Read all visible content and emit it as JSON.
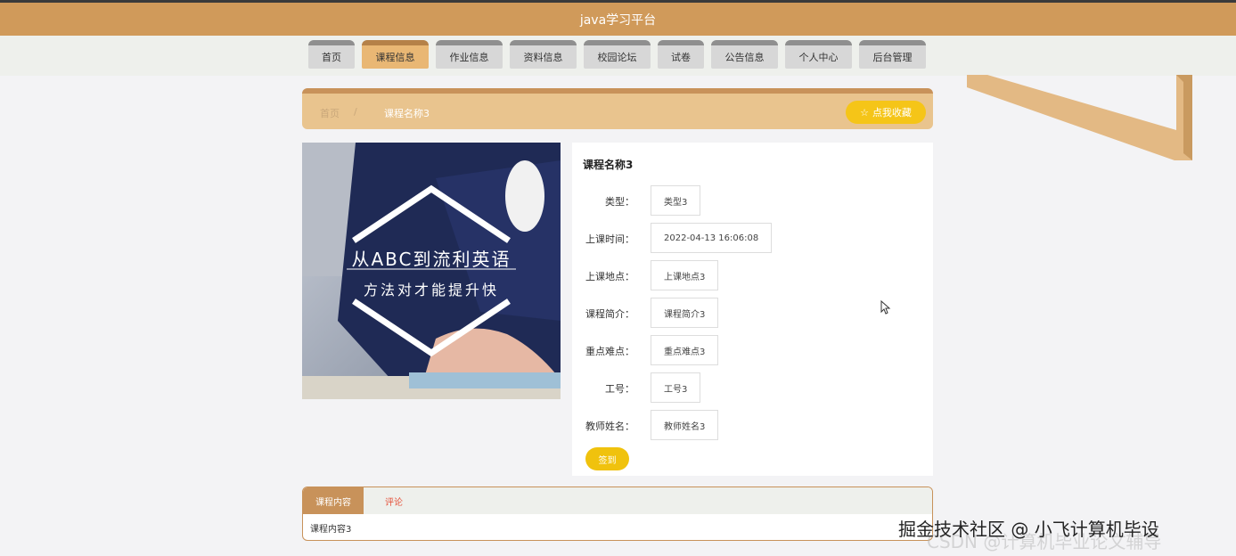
{
  "header": {
    "title": "java学习平台"
  },
  "nav": {
    "items": [
      {
        "label": "首页",
        "active": false,
        "width": 52
      },
      {
        "label": "课程信息",
        "active": true,
        "width": 75
      },
      {
        "label": "作业信息",
        "active": false,
        "width": 75
      },
      {
        "label": "资料信息",
        "active": false,
        "width": 75
      },
      {
        "label": "校园论坛",
        "active": false,
        "width": 75
      },
      {
        "label": "试卷",
        "active": false,
        "width": 52
      },
      {
        "label": "公告信息",
        "active": false,
        "width": 75
      },
      {
        "label": "个人中心",
        "active": false,
        "width": 75
      },
      {
        "label": "后台管理",
        "active": false,
        "width": 75
      }
    ]
  },
  "breadcrumb": {
    "home": "首页",
    "separator": "/",
    "current": "课程名称3"
  },
  "favorite": {
    "label": "点我收藏",
    "icon": "star-icon"
  },
  "course_image": {
    "line1": "从ABC到流利英语",
    "line2": "方法对才能提升快"
  },
  "detail": {
    "title": "课程名称3",
    "fields": [
      {
        "label": "类型：",
        "value": "类型3"
      },
      {
        "label": "上课时间：",
        "value": "2022-04-13 16:06:08"
      },
      {
        "label": "上课地点：",
        "value": "上课地点3"
      },
      {
        "label": "课程简介：",
        "value": "课程简介3"
      },
      {
        "label": "重点难点：",
        "value": "重点难点3"
      },
      {
        "label": "工号：",
        "value": "工号3"
      },
      {
        "label": "教师姓名：",
        "value": "教师姓名3"
      }
    ],
    "signin_label": "签到"
  },
  "tabs": {
    "items": [
      {
        "label": "课程内容"
      },
      {
        "label": "评论"
      }
    ],
    "content": "课程内容3"
  },
  "watermark": {
    "text": "掘金技术社区 @ 小飞计算机毕设",
    "faint": "CSDN @计算机毕业论文辅导"
  },
  "colors": {
    "brand": "#d09a5a",
    "accent": "#f5c518",
    "tab_active": "#c8925a"
  }
}
